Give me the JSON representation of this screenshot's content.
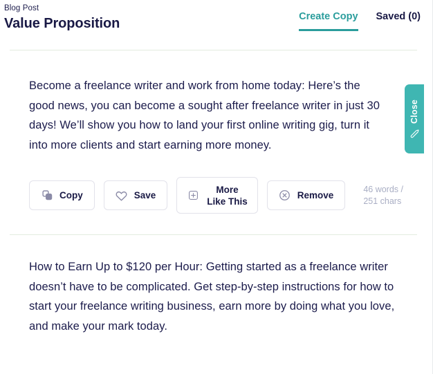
{
  "header": {
    "eyebrow": "Blog Post",
    "title": "Value Proposition",
    "tabs": [
      {
        "label": "Create Copy",
        "active": true
      },
      {
        "label": "Saved (0)",
        "active": false
      }
    ]
  },
  "side_tab": {
    "label": "Close",
    "icon": "pencil-icon",
    "color": "#3fb6b2"
  },
  "results": [
    {
      "text": "Become a freelance writer and work from home today: Here’s the good news, you can become a sought after freelance writer in just 30 days! We’ll show you how to land your first online writing gig, turn it into more clients and start earning more money.",
      "actions": {
        "copy": "Copy",
        "save": "Save",
        "more_like_this_line1": "More",
        "more_like_this_line2": "Like This",
        "remove": "Remove"
      },
      "word_count_line1": "46 words /",
      "word_count_line2": "251 chars"
    },
    {
      "text": " How to Earn Up to $120 per Hour: Getting started as a freelance writer doesn’t have to be complicated. Get step-by-step instructions for how to start your freelance writing business, earn more by doing what you love, and make your mark today."
    }
  ],
  "colors": {
    "accent_teal": "#2a9d9c",
    "side_tab_teal": "#3fb6b2",
    "text_navy": "#191945",
    "muted_gray": "#a9aec4",
    "icon_gray": "#8b8ba7",
    "border_gray": "#e2e2ea",
    "divider_green": "#e3ecdf"
  }
}
